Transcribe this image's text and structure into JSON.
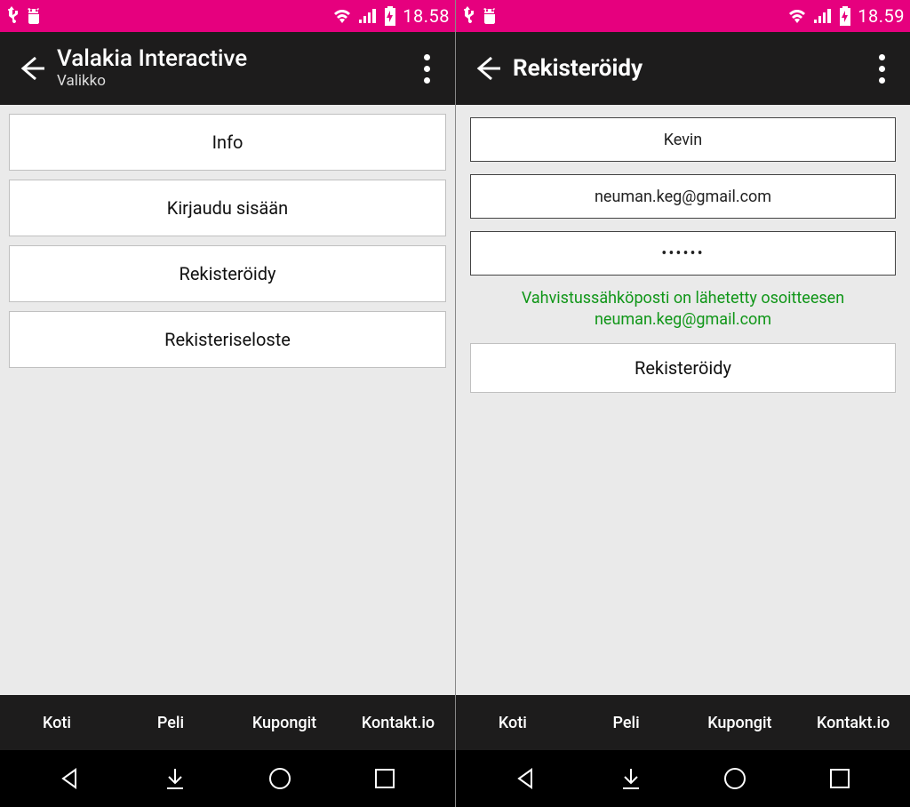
{
  "left": {
    "status_time": "18.58",
    "app_title": "Valakia Interactive",
    "app_subtitle": "Valikko",
    "menu": {
      "info": "Info",
      "login": "Kirjaudu sisään",
      "register": "Rekisteröidy",
      "privacy": "Rekisteriseloste"
    }
  },
  "right": {
    "status_time": "18.59",
    "app_title": "Rekisteröidy",
    "form": {
      "name": "Kevin",
      "email": "neuman.keg@gmail.com",
      "password": "••••••",
      "confirm_line1": "Vahvistussähköposti on lähetetty osoitteesen",
      "confirm_line2": "neuman.keg@gmail.com",
      "submit": "Rekisteröidy"
    }
  },
  "tabs": {
    "home": "Koti",
    "game": "Peli",
    "coupons": "Kupongit",
    "kontakt": "Kontakt.io"
  }
}
